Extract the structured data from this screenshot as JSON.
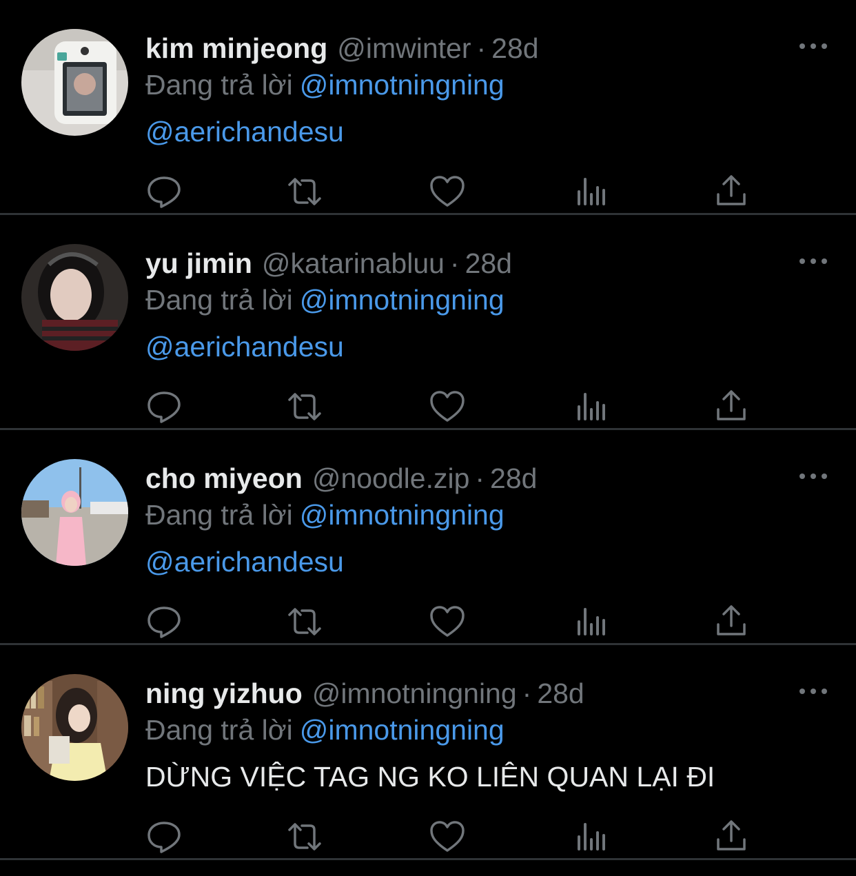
{
  "colors": {
    "background": "#000000",
    "primary_text": "#e7e9ea",
    "secondary_text": "#71767b",
    "link": "#4a99e9",
    "divider": "#2f3336"
  },
  "replying_label": "Đang trả lời",
  "tweets": [
    {
      "display_name": "kim minjeong",
      "handle": "@imwinter",
      "time": "28d",
      "reply_to": "@imnotningning",
      "text": "@aerichandesu",
      "avatar_icon": "avatar-photo"
    },
    {
      "display_name": "yu jimin",
      "handle": "@katarinabluu",
      "time": "28d",
      "reply_to": "@imnotningning",
      "text": "@aerichandesu",
      "avatar_icon": "avatar-photo"
    },
    {
      "display_name": "cho miyeon",
      "handle": "@noodle.zip",
      "time": "28d",
      "reply_to": "@imnotningning",
      "text": "@aerichandesu",
      "avatar_icon": "avatar-photo"
    },
    {
      "display_name": "ning yizhuo",
      "handle": "@imnotningning",
      "time": "28d",
      "reply_to": "@imnotningning",
      "text": "DỪNG VIỆC TAG NG KO LIÊN QUAN LẠI ĐI",
      "avatar_icon": "avatar-photo"
    }
  ],
  "actions": [
    "reply-icon",
    "retweet-icon",
    "like-icon",
    "views-icon",
    "share-icon"
  ],
  "separator": "·"
}
